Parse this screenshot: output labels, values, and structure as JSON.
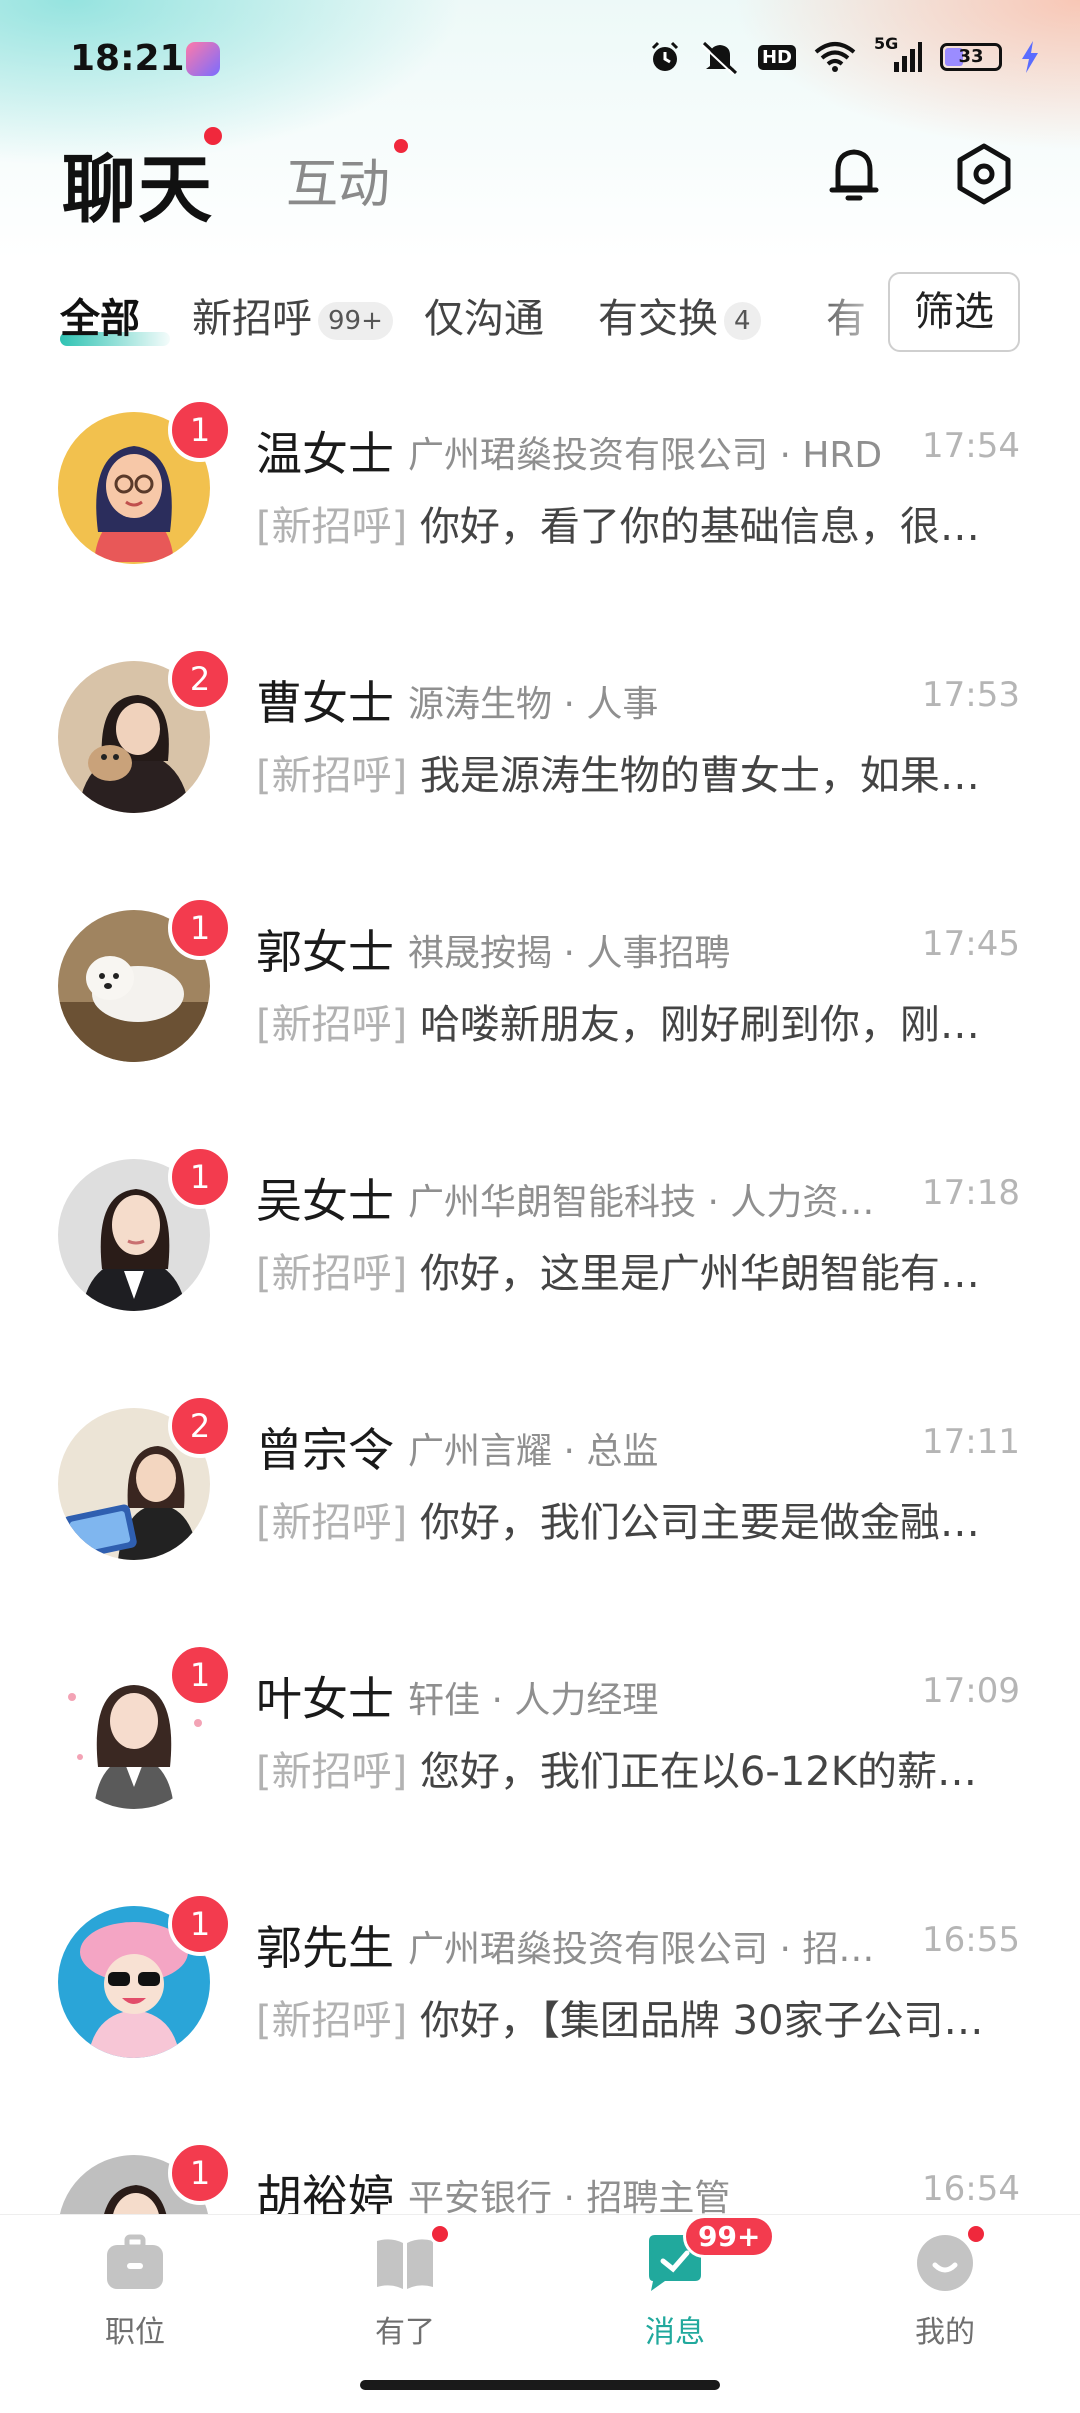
{
  "status_bar": {
    "time": "18:21",
    "network": "5G",
    "battery_level": "33",
    "icons": [
      "alarm-icon",
      "mute-icon",
      "hd-icon",
      "wifi-icon",
      "signal-icon",
      "battery-icon",
      "charging-icon"
    ]
  },
  "header": {
    "title": "聊天",
    "tab_interact": "互动",
    "hd_label": "HD"
  },
  "filters": {
    "tabs": [
      {
        "label": "全部",
        "badge": ""
      },
      {
        "label": "新招呼",
        "badge": "99+"
      },
      {
        "label": "仅沟通",
        "badge": ""
      },
      {
        "label": "有交换",
        "badge": "4"
      },
      {
        "label": "有",
        "badge": ""
      }
    ],
    "filter_button": "筛选"
  },
  "chats": [
    {
      "name": "温女士",
      "company": "广州珺燊投资有限公司 · HRD",
      "time": "17:54",
      "tag": "[新招呼]",
      "preview": "你好，看了你的基础信息，很…",
      "unread": "1"
    },
    {
      "name": "曹女士",
      "company": "源涛生物 · 人事",
      "time": "17:53",
      "tag": "[新招呼]",
      "preview": "我是源涛生物的曹女士，如果…",
      "unread": "2"
    },
    {
      "name": "郭女士",
      "company": "祺晟按揭 · 人事招聘",
      "time": "17:45",
      "tag": "[新招呼]",
      "preview": "哈喽新朋友，刚好刷到你，刚…",
      "unread": "1"
    },
    {
      "name": "吴女士",
      "company": "广州华朗智能科技 · 人力资…",
      "time": "17:18",
      "tag": "[新招呼]",
      "preview": "你好，这里是广州华朗智能有…",
      "unread": "1"
    },
    {
      "name": "曾宗令",
      "company": "广州言耀 · 总监",
      "time": "17:11",
      "tag": "[新招呼]",
      "preview": "你好，我们公司主要是做金融…",
      "unread": "2"
    },
    {
      "name": "叶女士",
      "company": "轩佳 · 人力经理",
      "time": "17:09",
      "tag": "[新招呼]",
      "preview": "您好，我们正在以6-12K的薪资…",
      "unread": "1"
    },
    {
      "name": "郭先生",
      "company": "广州珺燊投资有限公司 · 招…",
      "time": "16:55",
      "tag": "[新招呼]",
      "preview": "你好，【集团品牌 30家子公司…",
      "unread": "1"
    },
    {
      "name": "胡裕婷",
      "company": "平安银行 · 招聘主管",
      "time": "16:54",
      "tag": "",
      "preview": "",
      "unread": "1"
    }
  ],
  "bottom_nav": {
    "items": [
      {
        "label": "职位",
        "icon": "briefcase-icon"
      },
      {
        "label": "有了",
        "icon": "book-icon"
      },
      {
        "label": "消息",
        "icon": "chat-icon",
        "badge": "99+"
      },
      {
        "label": "我的",
        "icon": "profile-icon"
      }
    ]
  },
  "colors": {
    "accent": "#21a99d",
    "badge": "#f33b4e",
    "muted": "#8f8f8f"
  }
}
